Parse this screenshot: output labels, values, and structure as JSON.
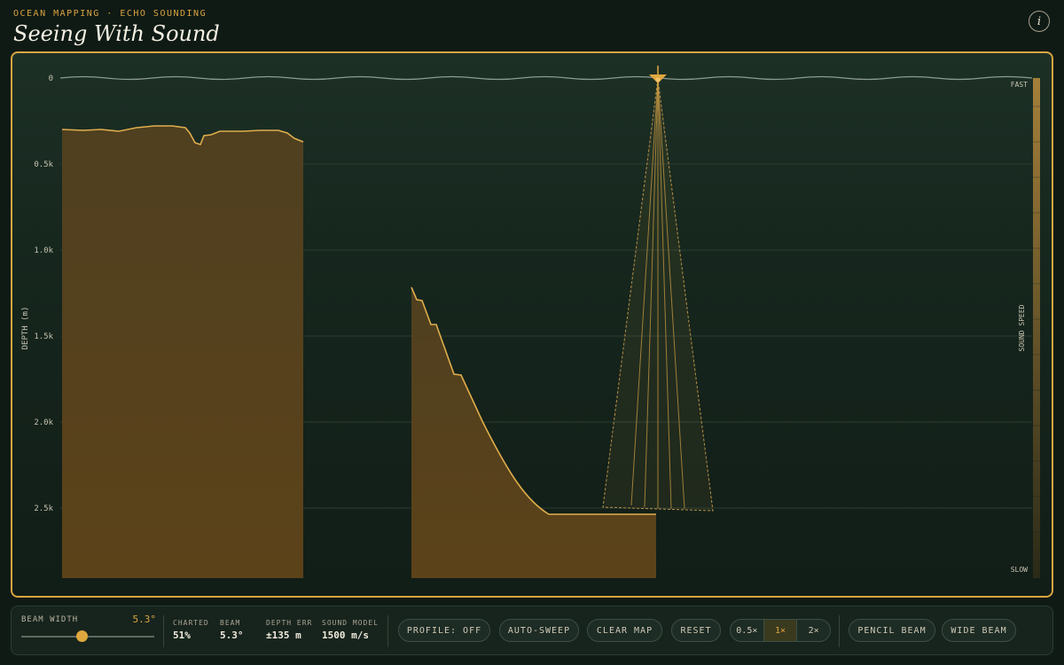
{
  "header": {
    "kicker": "OCEAN MAPPING · ECHO SOUNDING",
    "title": "Seeing With Sound",
    "info_icon_glyph": "i"
  },
  "chart": {
    "y_axis_title": "DEPTH (m)",
    "y_ticks": [
      "0",
      "0.5k",
      "1.0k",
      "1.5k",
      "2.0k",
      "2.5k"
    ],
    "sound_speed_label": "SOUND SPEED",
    "sound_speed_top": "FAST",
    "sound_speed_bottom": "SLOW"
  },
  "chart_data": {
    "type": "area",
    "ylabel": "DEPTH (m)",
    "ylim": [
      0,
      2900
    ],
    "y_inverted": true,
    "charted_segments": [
      {
        "depths_m": [
          300,
          310,
          300,
          300,
          305,
          320,
          290,
          275,
          275,
          285,
          300,
          380,
          330,
          310,
          305,
          300,
          300,
          310,
          370
        ]
      },
      {
        "depths_m": [
          1220,
          1300,
          1450,
          1720,
          2000,
          2300,
          2520,
          2550,
          2550
        ]
      }
    ],
    "beam_half_angle_deg": 5.3
  },
  "controls": {
    "beam_width_label": "BEAM WIDTH",
    "beam_width_value": "5.3°",
    "beam_width_fraction": 0.45,
    "stats": [
      {
        "label": "CHARTED",
        "value": "51%"
      },
      {
        "label": "BEAM",
        "value": "5.3°"
      },
      {
        "label": "DEPTH ERR",
        "value": "±135 m"
      },
      {
        "label": "SOUND MODEL",
        "value": "1500 m/s"
      }
    ],
    "profile_button": "PROFILE: OFF",
    "auto_sweep_button": "AUTO-SWEEP",
    "clear_map_button": "CLEAR MAP",
    "reset_button": "RESET",
    "speed_options": [
      "0.5×",
      "1×",
      "2×"
    ],
    "speed_selected": "1×",
    "pencil_beam_button": "PENCIL BEAM",
    "wide_beam_button": "WIDE BEAM"
  },
  "colors": {
    "accent": "#d9a441",
    "seafloor_fill": "#5a4219",
    "background": "#0f1a15"
  }
}
